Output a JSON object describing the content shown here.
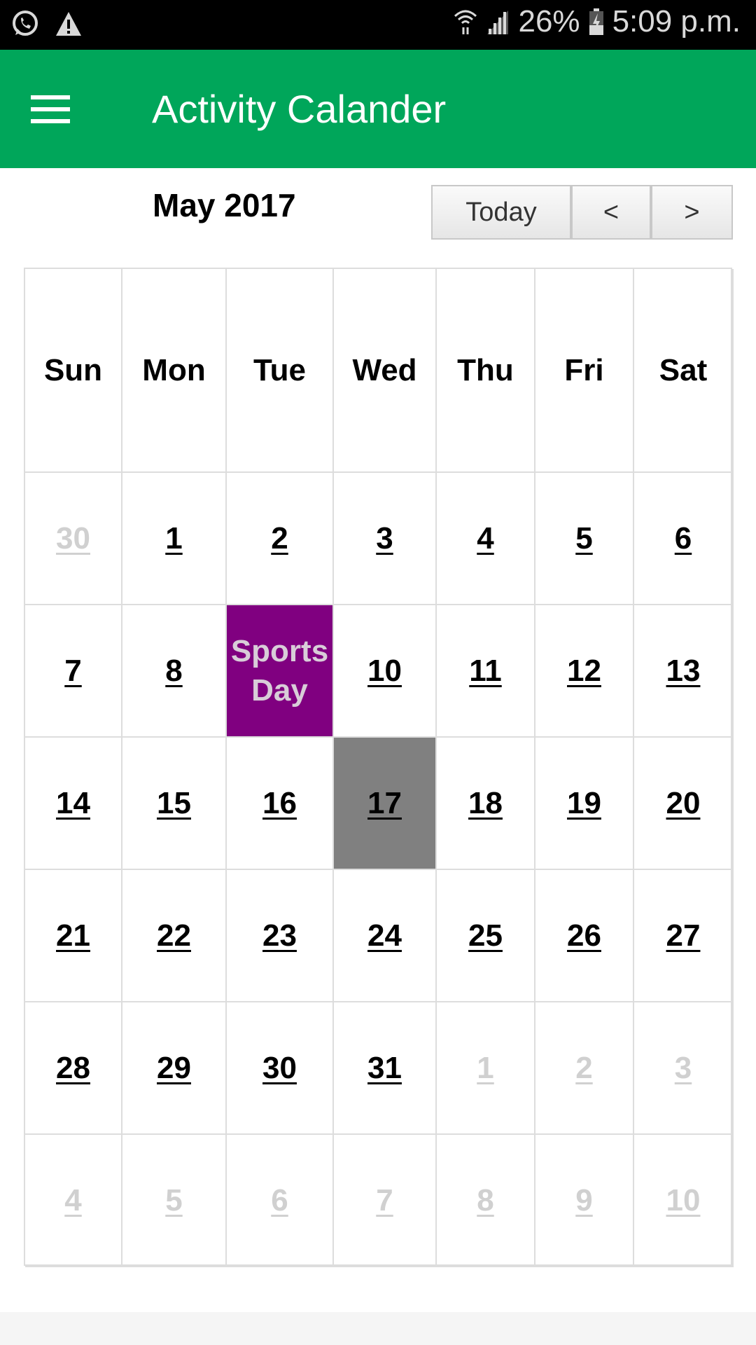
{
  "status_bar": {
    "battery": "26%",
    "time": "5:09 p.m.",
    "icons": [
      "whatsapp-icon",
      "warning-icon",
      "wifi-icon",
      "signal-icon",
      "battery-charging-icon"
    ]
  },
  "app_bar": {
    "title": "Activity Calander",
    "menu_icon": "hamburger-menu-icon"
  },
  "calendar": {
    "month_title": "May 2017",
    "buttons": {
      "today": "Today",
      "prev": "<",
      "next": ">"
    },
    "weekdays": [
      "Sun",
      "Mon",
      "Tue",
      "Wed",
      "Thu",
      "Fri",
      "Sat"
    ],
    "colors": {
      "event": "#800080",
      "today": "#808080",
      "muted": "#d0d0d0"
    },
    "weeks": [
      [
        {
          "label": "30",
          "muted": true
        },
        {
          "label": "1"
        },
        {
          "label": "2"
        },
        {
          "label": "3"
        },
        {
          "label": "4"
        },
        {
          "label": "5"
        },
        {
          "label": "6"
        }
      ],
      [
        {
          "label": "7"
        },
        {
          "label": "8"
        },
        {
          "label": "Sports Day",
          "event": true
        },
        {
          "label": "10"
        },
        {
          "label": "11"
        },
        {
          "label": "12"
        },
        {
          "label": "13"
        }
      ],
      [
        {
          "label": "14"
        },
        {
          "label": "15"
        },
        {
          "label": "16"
        },
        {
          "label": "17",
          "today": true
        },
        {
          "label": "18"
        },
        {
          "label": "19"
        },
        {
          "label": "20"
        }
      ],
      [
        {
          "label": "21"
        },
        {
          "label": "22"
        },
        {
          "label": "23"
        },
        {
          "label": "24"
        },
        {
          "label": "25"
        },
        {
          "label": "26"
        },
        {
          "label": "27"
        }
      ],
      [
        {
          "label": "28"
        },
        {
          "label": "29"
        },
        {
          "label": "30"
        },
        {
          "label": "31"
        },
        {
          "label": "1",
          "muted": true
        },
        {
          "label": "2",
          "muted": true
        },
        {
          "label": "3",
          "muted": true
        }
      ],
      [
        {
          "label": "4",
          "muted": true
        },
        {
          "label": "5",
          "muted": true
        },
        {
          "label": "6",
          "muted": true
        },
        {
          "label": "7",
          "muted": true
        },
        {
          "label": "8",
          "muted": true
        },
        {
          "label": "9",
          "muted": true
        },
        {
          "label": "10",
          "muted": true
        }
      ]
    ]
  }
}
